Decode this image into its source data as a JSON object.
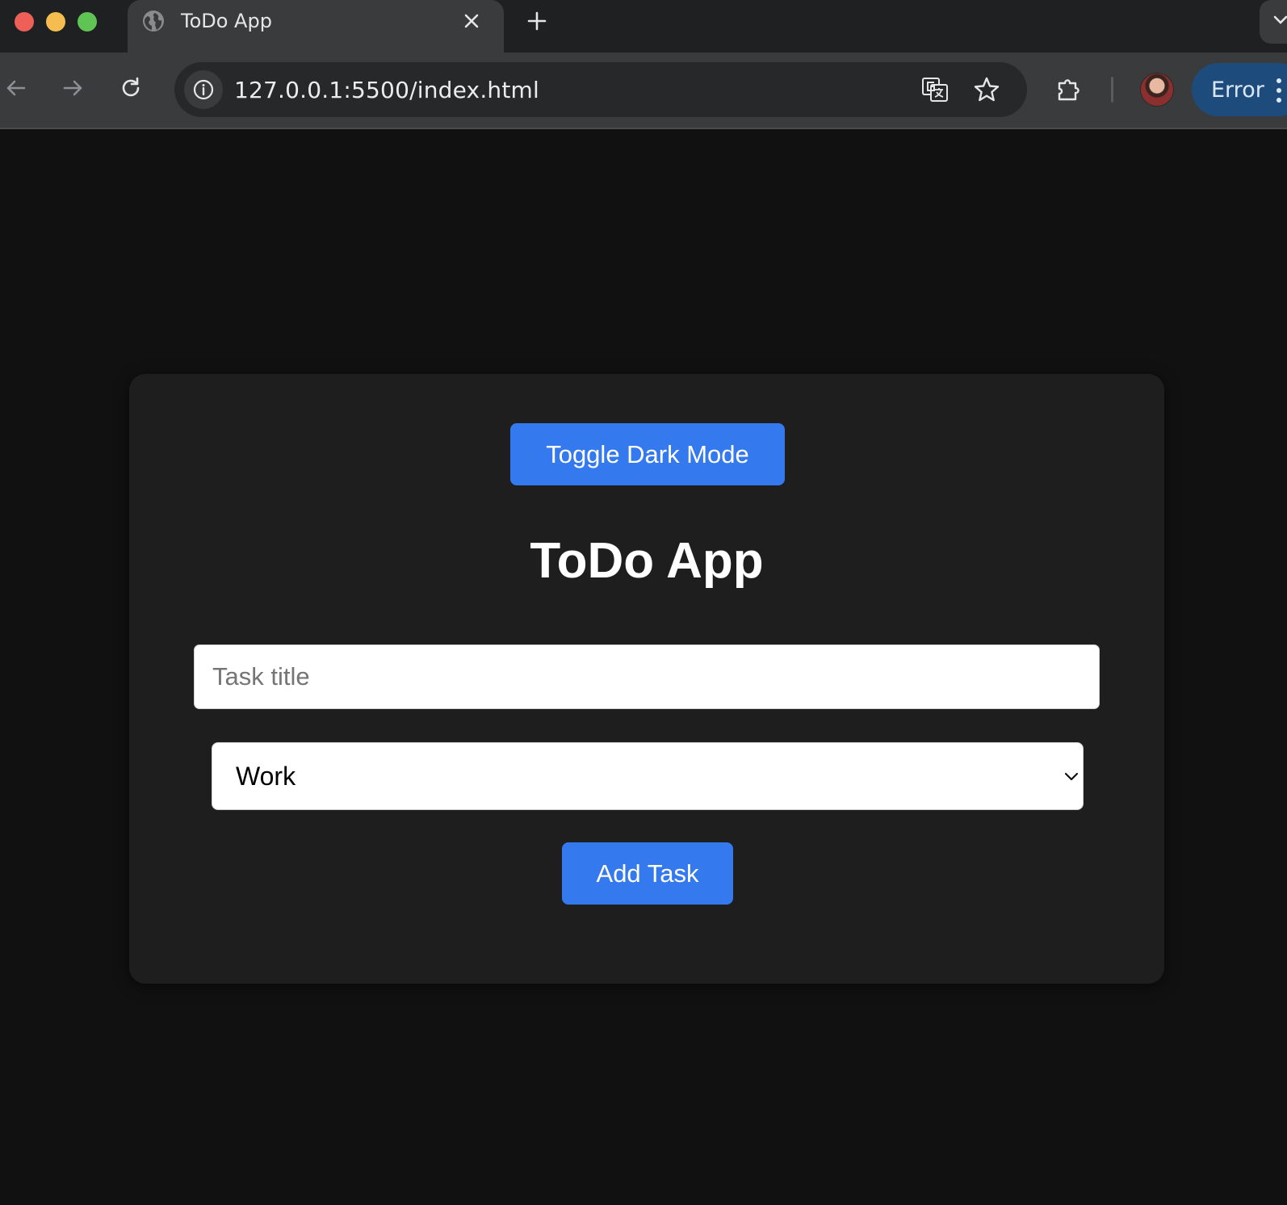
{
  "browser": {
    "tab": {
      "title": "ToDo App"
    },
    "address_bar": {
      "url": "127.0.0.1:5500/index.html"
    },
    "profile_status": {
      "label": "Error"
    },
    "icons": {
      "traffic_lights": [
        "close-dot",
        "minimize-dot",
        "maximize-dot"
      ],
      "tab_favicon": "globe-icon",
      "tab_close": "close-icon",
      "new_tab": "plus-icon",
      "back": "arrow-left-icon",
      "forward": "arrow-right-icon",
      "reload": "reload-icon",
      "site_info": "info-icon",
      "translate": "translate-icon",
      "bookmark": "star-icon",
      "extensions": "puzzle-icon",
      "menu": "kebab-menu-icon"
    }
  },
  "app": {
    "toggle_button": {
      "label": "Toggle Dark Mode"
    },
    "title": "ToDo App",
    "task_input": {
      "value": "",
      "placeholder": "Task title"
    },
    "category_select": {
      "selected": "Work"
    },
    "add_button": {
      "label": "Add Task"
    }
  },
  "colors": {
    "page_background": "#111112",
    "card_background": "#1e1e1f",
    "button_blue": "#3579ee",
    "error_pill": "#1d4b7c"
  }
}
